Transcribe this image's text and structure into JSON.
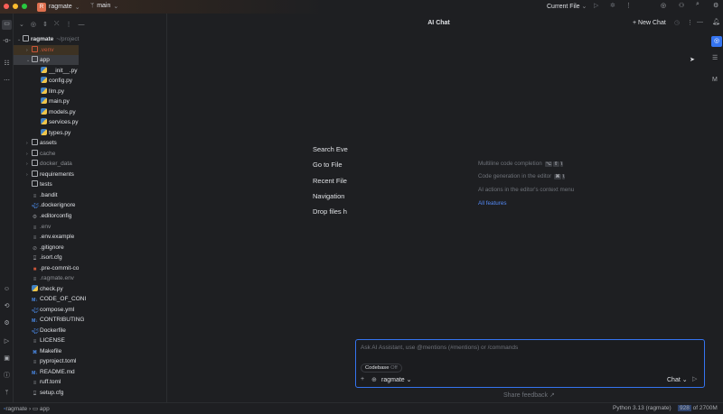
{
  "titlebar": {
    "project_initial": "R",
    "project": "ragmate",
    "branch": "main",
    "run_config": "Current File"
  },
  "chat": {
    "title": "AI Chat",
    "new_chat": "New Chat",
    "shortcuts": [
      "Search Eve",
      "Go to File",
      "Recent File",
      "Navigation",
      "Drop files h"
    ],
    "features": [
      {
        "label": "Multiline code completion",
        "keys": [
          "⌥",
          "⇧",
          "\\"
        ]
      },
      {
        "label": "Code generation in the editor",
        "keys": [
          "⌘",
          "\\"
        ]
      },
      {
        "label": "AI actions in the editor's context menu",
        "keys": []
      }
    ],
    "all_features": "All features",
    "input_placeholder": "Ask AI Assistant, use @mentions (#mentions) or /commands",
    "codebase": "Codebase",
    "codebase_state": "Off",
    "context": "ragmate",
    "mode": "Chat",
    "share_feedback": "Share feedback ↗"
  },
  "tree": [
    {
      "name": "ragmate",
      "extra": "~/project",
      "indent": 0,
      "type": "folder",
      "open": true
    },
    {
      "name": ".venv",
      "indent": 1,
      "type": "folder",
      "chev": true,
      "style": "venv"
    },
    {
      "name": "app",
      "indent": 1,
      "type": "folder",
      "open": true,
      "style": "sel"
    },
    {
      "name": "__init__.py",
      "indent": 2,
      "type": "py"
    },
    {
      "name": "config.py",
      "indent": 2,
      "type": "py"
    },
    {
      "name": "llm.py",
      "indent": 2,
      "type": "py"
    },
    {
      "name": "main.py",
      "indent": 2,
      "type": "py"
    },
    {
      "name": "models.py",
      "indent": 2,
      "type": "py"
    },
    {
      "name": "services.py",
      "indent": 2,
      "type": "py"
    },
    {
      "name": "types.py",
      "indent": 2,
      "type": "py"
    },
    {
      "name": "assets",
      "indent": 1,
      "type": "folder",
      "chev": true
    },
    {
      "name": "cache",
      "indent": 1,
      "type": "folder",
      "chev": true,
      "style": "dim"
    },
    {
      "name": "docker_data",
      "indent": 1,
      "type": "folder",
      "chev": true,
      "style": "dim"
    },
    {
      "name": "requirements",
      "indent": 1,
      "type": "folder",
      "chev": true
    },
    {
      "name": "tests",
      "indent": 1,
      "type": "folder"
    },
    {
      "name": ".bandit",
      "indent": 1,
      "type": "txt"
    },
    {
      "name": ".dockerignore",
      "indent": 1,
      "type": "docker"
    },
    {
      "name": ".editorconfig",
      "indent": 1,
      "type": "gear"
    },
    {
      "name": ".env",
      "indent": 1,
      "type": "txt",
      "style": "dim"
    },
    {
      "name": ".env.example",
      "indent": 1,
      "type": "txt"
    },
    {
      "name": ".gitignore",
      "indent": 1,
      "type": "ignore"
    },
    {
      "name": ".isort.cfg",
      "indent": 1,
      "type": "cfg"
    },
    {
      "name": ".pre-commit-co",
      "indent": 1,
      "type": "precommit"
    },
    {
      "name": ".ragmate.env",
      "indent": 1,
      "type": "txt",
      "style": "dim"
    },
    {
      "name": "check.py",
      "indent": 1,
      "type": "py"
    },
    {
      "name": "CODE_OF_CONI",
      "indent": 1,
      "type": "md"
    },
    {
      "name": "compose.yml",
      "indent": 1,
      "type": "docker"
    },
    {
      "name": "CONTRIBUTING",
      "indent": 1,
      "type": "md"
    },
    {
      "name": "Dockerfile",
      "indent": 1,
      "type": "docker"
    },
    {
      "name": "LICENSE",
      "indent": 1,
      "type": "txt"
    },
    {
      "name": "Makefile",
      "indent": 1,
      "type": "make"
    },
    {
      "name": "pyproject.toml",
      "indent": 1,
      "type": "txt"
    },
    {
      "name": "README.md",
      "indent": 1,
      "type": "md"
    },
    {
      "name": "ruff.toml",
      "indent": 1,
      "type": "txt"
    },
    {
      "name": "setup.cfg",
      "indent": 1,
      "type": "cfg"
    }
  ],
  "status": {
    "crumbs": [
      "ragmate",
      "app"
    ],
    "interpreter": "Python 3.13 (ragmate)",
    "memory_used": "928",
    "memory_total": "of 2700M"
  },
  "colors": {
    "accent": "#3574f0",
    "link": "#548af7"
  }
}
